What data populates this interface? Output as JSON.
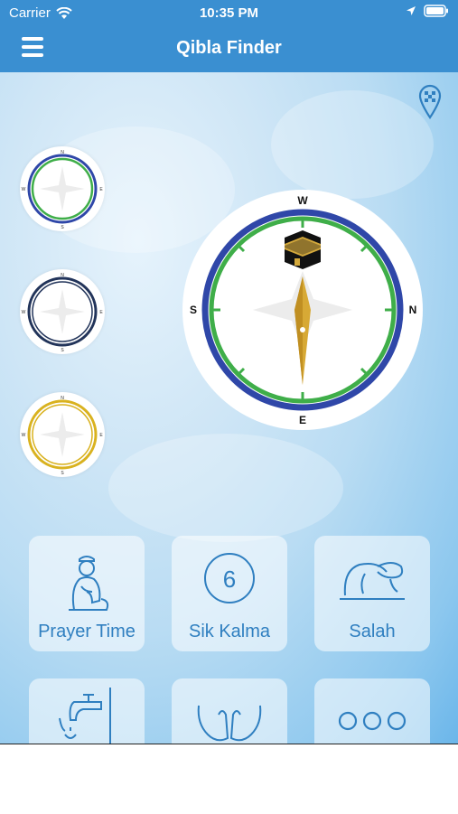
{
  "status_bar": {
    "carrier": "Carrier",
    "time": "10:35 PM"
  },
  "header": {
    "title": "Qibla Finder",
    "menu_icon": "hamburger-menu-icon"
  },
  "location_icon": "location-pin-icon",
  "compass": {
    "north": "N",
    "south": "S",
    "east": "E",
    "west": "W"
  },
  "compass_styles": [
    {
      "name": "green-blue",
      "ring_outer": "#2f47a8",
      "ring_inner": "#3fae49"
    },
    {
      "name": "navy",
      "ring_outer": "#22345a",
      "ring_inner": "#22345a"
    },
    {
      "name": "gold",
      "ring_outer": "#d9b21f",
      "ring_inner": "#d9b21f"
    }
  ],
  "colors": {
    "accent": "#3a8fd1",
    "tile_text": "#2f7fc0",
    "needle": "#d7a935",
    "kaaba_gold": "#d4a93c"
  },
  "tiles": [
    {
      "label": "Prayer Time",
      "icon": "praying-person-icon"
    },
    {
      "label": "Sik Kalma",
      "icon": "number-six-circle-icon",
      "number": "6"
    },
    {
      "label": "Salah",
      "icon": "prostration-icon"
    },
    {
      "label": "",
      "icon": "water-tap-icon"
    },
    {
      "label": "",
      "icon": "praying-hands-icon"
    },
    {
      "label": "",
      "icon": "more-dots-icon"
    }
  ]
}
